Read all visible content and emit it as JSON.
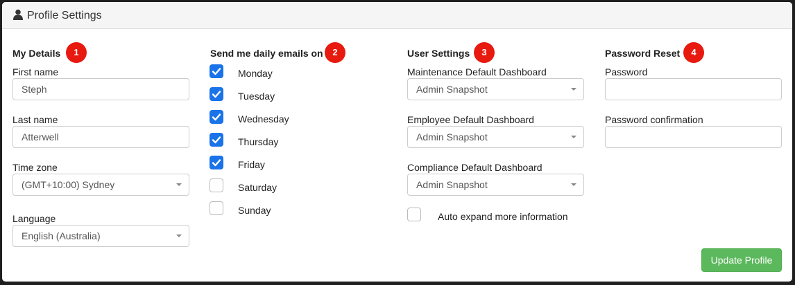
{
  "header": {
    "title": "Profile Settings",
    "icon": "user-icon"
  },
  "my_details": {
    "title": "My Details",
    "badge": "1",
    "first_name_label": "First name",
    "first_name_value": "Steph",
    "last_name_label": "Last name",
    "last_name_value": "Atterwell",
    "time_zone_label": "Time zone",
    "time_zone_value": "(GMT+10:00) Sydney",
    "language_label": "Language",
    "language_value": "English (Australia)"
  },
  "emails": {
    "title": "Send me daily emails on",
    "badge": "2",
    "days": [
      {
        "label": "Monday",
        "checked": true
      },
      {
        "label": "Tuesday",
        "checked": true
      },
      {
        "label": "Wednesday",
        "checked": true
      },
      {
        "label": "Thursday",
        "checked": true
      },
      {
        "label": "Friday",
        "checked": true
      },
      {
        "label": "Saturday",
        "checked": false
      },
      {
        "label": "Sunday",
        "checked": false
      }
    ]
  },
  "user_settings": {
    "title": "User Settings",
    "badge": "3",
    "maintenance_label": "Maintenance Default Dashboard",
    "maintenance_value": "Admin Snapshot",
    "employee_label": "Employee Default Dashboard",
    "employee_value": "Admin Snapshot",
    "compliance_label": "Compliance Default Dashboard",
    "compliance_value": "Admin Snapshot",
    "auto_expand_label": "Auto expand more information",
    "auto_expand_checked": false
  },
  "password_reset": {
    "title": "Password Reset",
    "badge": "4",
    "password_label": "Password",
    "password_value": "",
    "confirm_label": "Password confirmation",
    "confirm_value": ""
  },
  "actions": {
    "update_label": "Update Profile"
  },
  "colors": {
    "badge": "#e8190f",
    "checkbox": "#1a73e8",
    "button": "#5cb85c"
  }
}
